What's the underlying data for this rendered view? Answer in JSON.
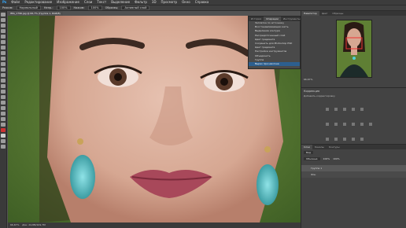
{
  "menu": [
    "Файл",
    "Редактирование",
    "Изображение",
    "Слои",
    "Текст",
    "Выделение",
    "Фильтр",
    "3D",
    "Просмотр",
    "Окно",
    "Справка"
  ],
  "options": {
    "mode_label": "Режим:",
    "mode_value": "Нормальный",
    "opacity_label": "Непр.:",
    "opacity_value": "100%",
    "flow_label": "Нажим:",
    "flow_value": "100%",
    "sample_label": "Образец:",
    "sample_value": "Активный слой"
  },
  "document_tab": "IMG_1796.jpg @ 66,7% (Группа 1, RGB/8)",
  "status": {
    "zoom": "66,67%",
    "doc": "Док: 24,8М/109,7М"
  },
  "history": {
    "tabs": [
      "История",
      "Операции",
      "Инструменты"
    ],
    "rows": [
      "Заплатка по источнику",
      "Восстанавливающая кисть",
      "Выделение контура",
      "Рассредоточенный слой",
      "Цвет градиента",
      "Сохранить для Photoshop PSD",
      "Цвет градиента",
      "Настройка инструментов",
      "Объединить",
      "Группа",
      "Вырез при наклоне"
    ],
    "active_index": 10
  },
  "navigator": {
    "tabs": [
      "Навигатор",
      "Цвет",
      "Образцы"
    ],
    "zoom": "66,67%"
  },
  "adjustments": {
    "title": "Коррекция",
    "subtitle": "Добавить корректировку"
  },
  "layers": {
    "tabs": [
      "Слои",
      "Каналы",
      "Контуры"
    ],
    "search": "Вид",
    "blend": "Обычные",
    "opacity": "100%",
    "fill": "100%",
    "items": [
      "Группа 1",
      "Фон"
    ]
  },
  "colors": {
    "accent": "#2d5f8f",
    "panel": "#434343",
    "bg": "#535353"
  }
}
